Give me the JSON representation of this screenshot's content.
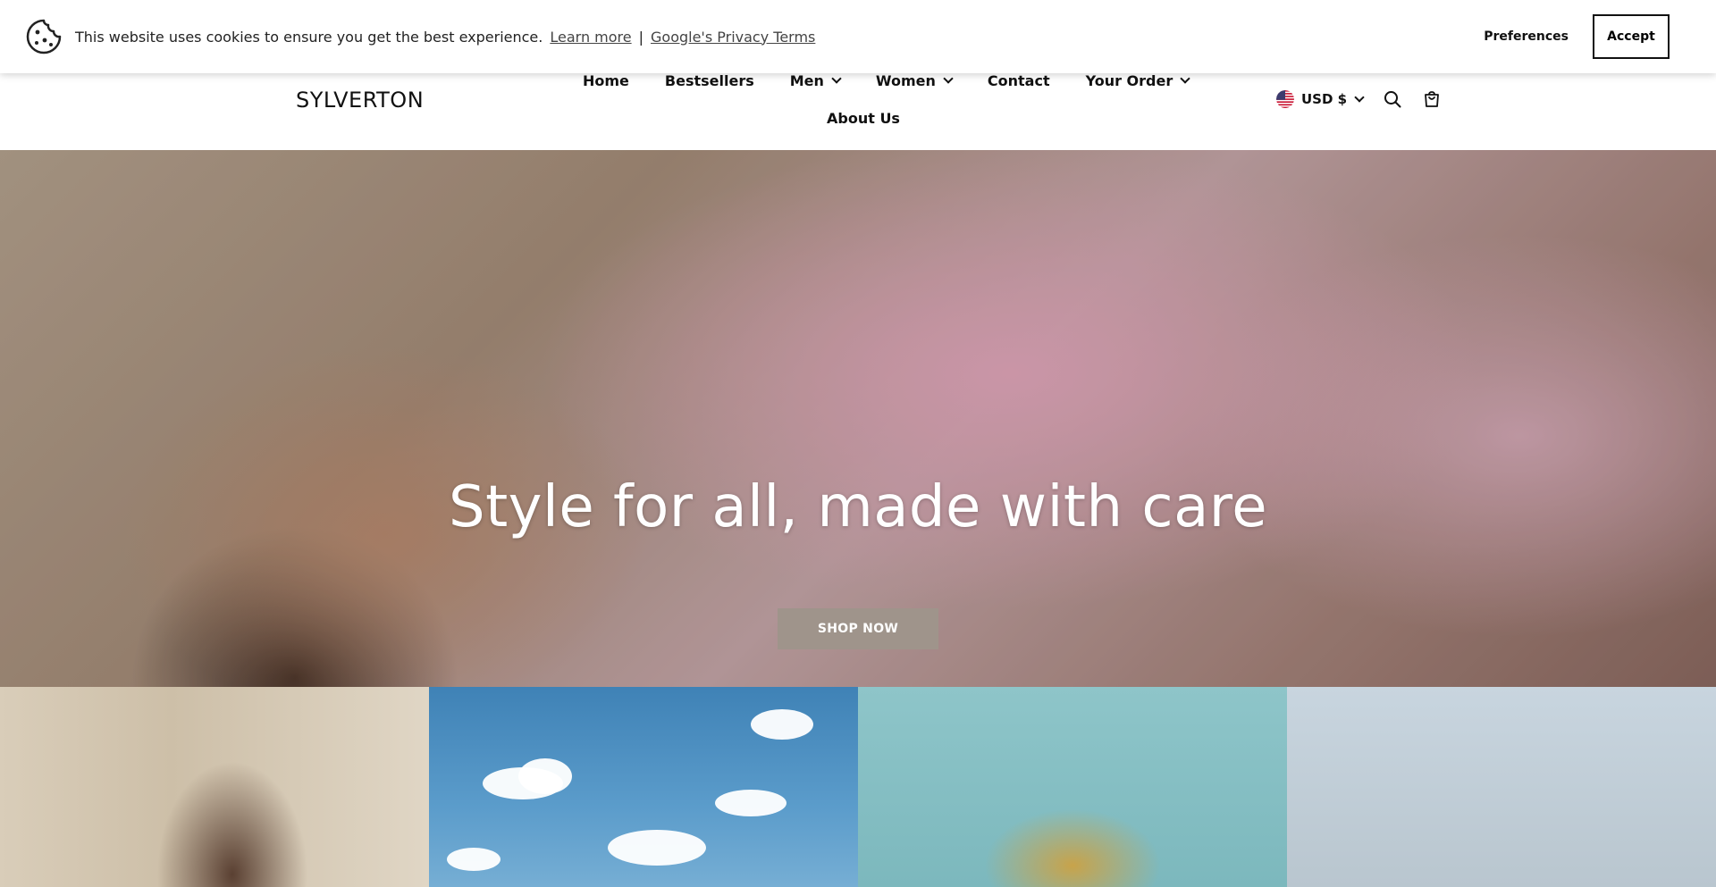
{
  "cookie_banner": {
    "message": "This website uses cookies to ensure you get the best experience.",
    "learn_more": "Learn more",
    "separator": "|",
    "privacy_terms": "Google's Privacy Terms",
    "preferences_label": "Preferences",
    "accept_label": "Accept"
  },
  "header": {
    "logo": "SYLVERTON",
    "nav": {
      "row1": [
        {
          "label": "Home",
          "has_dropdown": false
        },
        {
          "label": "Bestsellers",
          "has_dropdown": false
        },
        {
          "label": "Men",
          "has_dropdown": true
        },
        {
          "label": "Women",
          "has_dropdown": true
        },
        {
          "label": "Contact",
          "has_dropdown": false
        },
        {
          "label": "Your Order",
          "has_dropdown": true
        }
      ],
      "row2": [
        {
          "label": "About Us",
          "has_dropdown": false
        }
      ]
    },
    "currency": "USD $",
    "icons": [
      "us-flag-icon",
      "chevron-down-icon",
      "search-icon",
      "cart-icon"
    ]
  },
  "hero": {
    "title": "Style for all, made with care",
    "cta_label": "SHOP NOW",
    "cta_color": "#9f948b"
  },
  "colors": {
    "text": "#111111",
    "banner_bg": "#ffffff"
  }
}
